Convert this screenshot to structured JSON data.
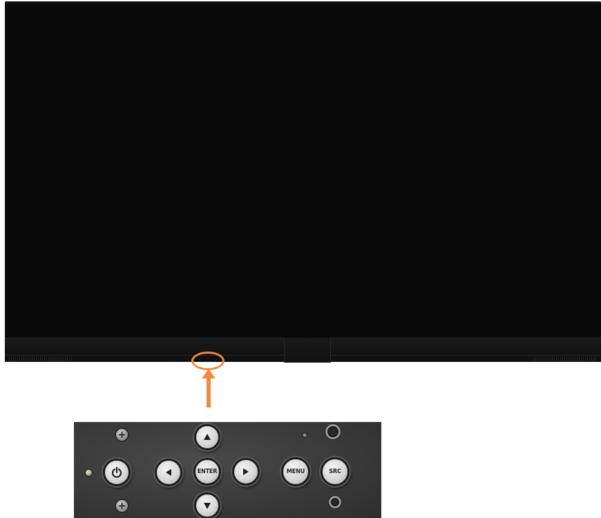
{
  "panel": {
    "enter_label": "ENTER",
    "menu_label": "MENU",
    "source_label": "SRC"
  },
  "colors": {
    "callout": "#f08a3c",
    "tv_body": "#121212",
    "panel": "#3a3a3a",
    "button": "#d8d8d8"
  },
  "icons": {
    "power": "power-icon",
    "up": "arrow-up-icon",
    "down": "arrow-down-icon",
    "left": "arrow-left-icon",
    "right": "arrow-right-icon"
  }
}
